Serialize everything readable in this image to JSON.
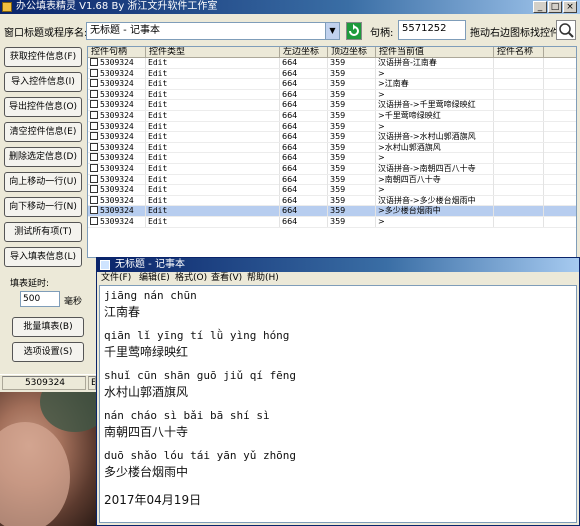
{
  "app": {
    "title": "办公填表精灵 V1.68 By 浙江文升软件工作室",
    "window_label": "窗口标题或程序名:",
    "window_value": "无标题 - 记事本",
    "handle_label": "句柄:",
    "handle_value": "5571252",
    "drag_label": "拖动右边图标找控件:"
  },
  "buttons": [
    {
      "label": "获取控件信息(F)"
    },
    {
      "label": "导入控件信息(I)"
    },
    {
      "label": "导出控件信息(O)"
    },
    {
      "label": "清空控件信息(E)"
    },
    {
      "label": "删除选定信息(D)"
    },
    {
      "label": "向上移动一行(U)"
    },
    {
      "label": "向下移动一行(N)"
    },
    {
      "label": "测试所有项(T)"
    },
    {
      "label": "导入填表信息(L)"
    }
  ],
  "delay": {
    "label": "填表延时:",
    "value": "500",
    "unit": "毫秒"
  },
  "batch_button": "批量填表(B)",
  "options_button": "选项设置(S)",
  "table": {
    "headers": [
      "控件句柄",
      "控件类型",
      "左边坐标",
      "顶边坐标",
      "控件当前值",
      "控件名称"
    ],
    "rows": [
      {
        "handle": "5309324",
        "type": "Edit",
        "x": "664",
        "y": "359",
        "value": "汉语拼音-江南春",
        "name": ""
      },
      {
        "handle": "5309324",
        "type": "Edit",
        "x": "664",
        "y": "359",
        "value": ">",
        "name": ""
      },
      {
        "handle": "5309324",
        "type": "Edit",
        "x": "664",
        "y": "359",
        "value": ">江南春",
        "name": ""
      },
      {
        "handle": "5309324",
        "type": "Edit",
        "x": "664",
        "y": "359",
        "value": ">",
        "name": ""
      },
      {
        "handle": "5309324",
        "type": "Edit",
        "x": "664",
        "y": "359",
        "value": "汉语拼音->千里莺啼绿映红",
        "name": ""
      },
      {
        "handle": "5309324",
        "type": "Edit",
        "x": "664",
        "y": "359",
        "value": ">千里莺啼绿映红",
        "name": ""
      },
      {
        "handle": "5309324",
        "type": "Edit",
        "x": "664",
        "y": "359",
        "value": ">",
        "name": ""
      },
      {
        "handle": "5309324",
        "type": "Edit",
        "x": "664",
        "y": "359",
        "value": "汉语拼音->水村山郭酒旗风",
        "name": ""
      },
      {
        "handle": "5309324",
        "type": "Edit",
        "x": "664",
        "y": "359",
        "value": ">水村山郭酒旗风",
        "name": ""
      },
      {
        "handle": "5309324",
        "type": "Edit",
        "x": "664",
        "y": "359",
        "value": ">",
        "name": ""
      },
      {
        "handle": "5309324",
        "type": "Edit",
        "x": "664",
        "y": "359",
        "value": "汉语拼音->南朝四百八十寺",
        "name": ""
      },
      {
        "handle": "5309324",
        "type": "Edit",
        "x": "664",
        "y": "359",
        "value": ">南朝四百八十寺",
        "name": ""
      },
      {
        "handle": "5309324",
        "type": "Edit",
        "x": "664",
        "y": "359",
        "value": ">",
        "name": ""
      },
      {
        "handle": "5309324",
        "type": "Edit",
        "x": "664",
        "y": "359",
        "value": "汉语拼音->多少楼台烟雨中",
        "name": ""
      },
      {
        "handle": "5309324",
        "type": "Edit",
        "x": "664",
        "y": "359",
        "value": ">多少楼台烟雨中",
        "name": ""
      },
      {
        "handle": "5309324",
        "type": "Edit",
        "x": "664",
        "y": "359",
        "value": ">",
        "name": ""
      }
    ],
    "selected_row": 14
  },
  "status": {
    "cell1": "5309324",
    "cell2": "E"
  },
  "notepad": {
    "title": "无标题 - 记事本",
    "menu": [
      "文件(F)",
      "编辑(E)",
      "格式(O)",
      "查看(V)",
      "帮助(H)"
    ],
    "lines": [
      {
        "text": "jiāng nán chūn",
        "pinyin": true
      },
      {
        "text": "江南春",
        "pinyin": false
      },
      {
        "text": "qiān lǐ yīng tí lǜ yìng hóng",
        "pinyin": true
      },
      {
        "text": "千里莺啼绿映红",
        "pinyin": false
      },
      {
        "text": "shuǐ cūn shān guō jiǔ qí fēng",
        "pinyin": true
      },
      {
        "text": "水村山郭酒旗风",
        "pinyin": false
      },
      {
        "text": "nán cháo sì bǎi bā shí sì",
        "pinyin": true
      },
      {
        "text": "南朝四百八十寺",
        "pinyin": false
      },
      {
        "text": "duō shǎo lóu tái yān yǔ zhōng",
        "pinyin": true
      },
      {
        "text": "多少楼台烟雨中",
        "pinyin": false
      },
      {
        "text": "2017年04月19日",
        "pinyin": false
      }
    ]
  }
}
